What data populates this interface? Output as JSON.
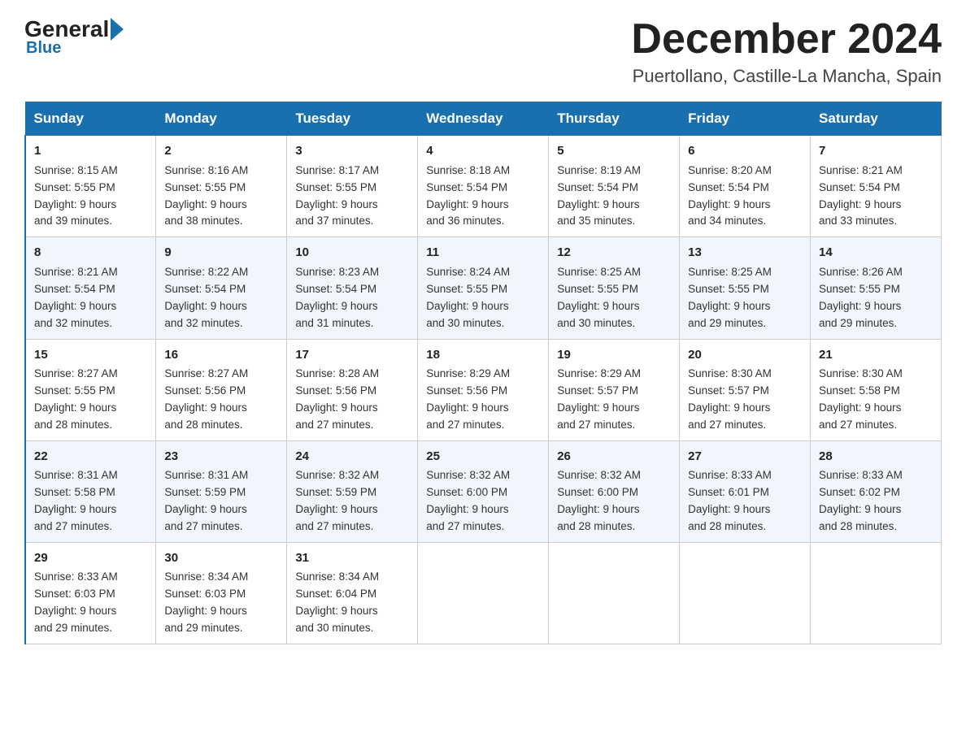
{
  "header": {
    "logo_general": "General",
    "logo_blue": "Blue",
    "month_title": "December 2024",
    "location": "Puertollano, Castille-La Mancha, Spain"
  },
  "weekdays": [
    "Sunday",
    "Monday",
    "Tuesday",
    "Wednesday",
    "Thursday",
    "Friday",
    "Saturday"
  ],
  "weeks": [
    [
      {
        "day": "1",
        "sunrise": "8:15 AM",
        "sunset": "5:55 PM",
        "daylight": "9 hours and 39 minutes."
      },
      {
        "day": "2",
        "sunrise": "8:16 AM",
        "sunset": "5:55 PM",
        "daylight": "9 hours and 38 minutes."
      },
      {
        "day": "3",
        "sunrise": "8:17 AM",
        "sunset": "5:55 PM",
        "daylight": "9 hours and 37 minutes."
      },
      {
        "day": "4",
        "sunrise": "8:18 AM",
        "sunset": "5:54 PM",
        "daylight": "9 hours and 36 minutes."
      },
      {
        "day": "5",
        "sunrise": "8:19 AM",
        "sunset": "5:54 PM",
        "daylight": "9 hours and 35 minutes."
      },
      {
        "day": "6",
        "sunrise": "8:20 AM",
        "sunset": "5:54 PM",
        "daylight": "9 hours and 34 minutes."
      },
      {
        "day": "7",
        "sunrise": "8:21 AM",
        "sunset": "5:54 PM",
        "daylight": "9 hours and 33 minutes."
      }
    ],
    [
      {
        "day": "8",
        "sunrise": "8:21 AM",
        "sunset": "5:54 PM",
        "daylight": "9 hours and 32 minutes."
      },
      {
        "day": "9",
        "sunrise": "8:22 AM",
        "sunset": "5:54 PM",
        "daylight": "9 hours and 32 minutes."
      },
      {
        "day": "10",
        "sunrise": "8:23 AM",
        "sunset": "5:54 PM",
        "daylight": "9 hours and 31 minutes."
      },
      {
        "day": "11",
        "sunrise": "8:24 AM",
        "sunset": "5:55 PM",
        "daylight": "9 hours and 30 minutes."
      },
      {
        "day": "12",
        "sunrise": "8:25 AM",
        "sunset": "5:55 PM",
        "daylight": "9 hours and 30 minutes."
      },
      {
        "day": "13",
        "sunrise": "8:25 AM",
        "sunset": "5:55 PM",
        "daylight": "9 hours and 29 minutes."
      },
      {
        "day": "14",
        "sunrise": "8:26 AM",
        "sunset": "5:55 PM",
        "daylight": "9 hours and 29 minutes."
      }
    ],
    [
      {
        "day": "15",
        "sunrise": "8:27 AM",
        "sunset": "5:55 PM",
        "daylight": "9 hours and 28 minutes."
      },
      {
        "day": "16",
        "sunrise": "8:27 AM",
        "sunset": "5:56 PM",
        "daylight": "9 hours and 28 minutes."
      },
      {
        "day": "17",
        "sunrise": "8:28 AM",
        "sunset": "5:56 PM",
        "daylight": "9 hours and 27 minutes."
      },
      {
        "day": "18",
        "sunrise": "8:29 AM",
        "sunset": "5:56 PM",
        "daylight": "9 hours and 27 minutes."
      },
      {
        "day": "19",
        "sunrise": "8:29 AM",
        "sunset": "5:57 PM",
        "daylight": "9 hours and 27 minutes."
      },
      {
        "day": "20",
        "sunrise": "8:30 AM",
        "sunset": "5:57 PM",
        "daylight": "9 hours and 27 minutes."
      },
      {
        "day": "21",
        "sunrise": "8:30 AM",
        "sunset": "5:58 PM",
        "daylight": "9 hours and 27 minutes."
      }
    ],
    [
      {
        "day": "22",
        "sunrise": "8:31 AM",
        "sunset": "5:58 PM",
        "daylight": "9 hours and 27 minutes."
      },
      {
        "day": "23",
        "sunrise": "8:31 AM",
        "sunset": "5:59 PM",
        "daylight": "9 hours and 27 minutes."
      },
      {
        "day": "24",
        "sunrise": "8:32 AM",
        "sunset": "5:59 PM",
        "daylight": "9 hours and 27 minutes."
      },
      {
        "day": "25",
        "sunrise": "8:32 AM",
        "sunset": "6:00 PM",
        "daylight": "9 hours and 27 minutes."
      },
      {
        "day": "26",
        "sunrise": "8:32 AM",
        "sunset": "6:00 PM",
        "daylight": "9 hours and 28 minutes."
      },
      {
        "day": "27",
        "sunrise": "8:33 AM",
        "sunset": "6:01 PM",
        "daylight": "9 hours and 28 minutes."
      },
      {
        "day": "28",
        "sunrise": "8:33 AM",
        "sunset": "6:02 PM",
        "daylight": "9 hours and 28 minutes."
      }
    ],
    [
      {
        "day": "29",
        "sunrise": "8:33 AM",
        "sunset": "6:03 PM",
        "daylight": "9 hours and 29 minutes."
      },
      {
        "day": "30",
        "sunrise": "8:34 AM",
        "sunset": "6:03 PM",
        "daylight": "9 hours and 29 minutes."
      },
      {
        "day": "31",
        "sunrise": "8:34 AM",
        "sunset": "6:04 PM",
        "daylight": "9 hours and 30 minutes."
      },
      null,
      null,
      null,
      null
    ]
  ]
}
